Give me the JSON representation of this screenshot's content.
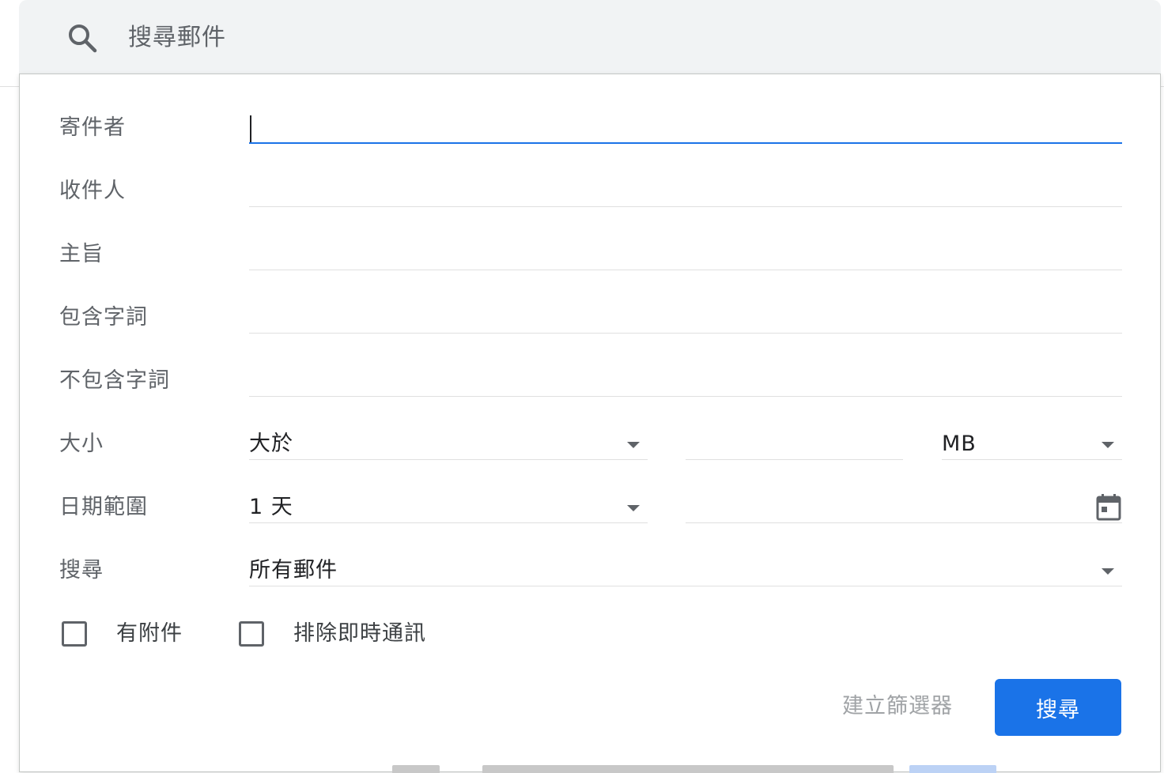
{
  "search": {
    "placeholder": "搜尋郵件"
  },
  "form": {
    "from_label": "寄件者",
    "to_label": "收件人",
    "subject_label": "主旨",
    "has_words_label": "包含字詞",
    "no_words_label": "不包含字詞",
    "size_label": "大小",
    "size_comparator": "大於",
    "size_unit": "MB",
    "date_range_label": "日期範圍",
    "date_range_value": "1 天",
    "search_in_label": "搜尋",
    "search_in_value": "所有郵件",
    "has_attachment_label": "有附件",
    "exclude_chats_label": "排除即時通訊"
  },
  "actions": {
    "create_filter": "建立篩選器",
    "search": "搜尋"
  },
  "colors": {
    "accent": "#1a73e8",
    "search_bar_bg": "#f1f3f4"
  }
}
